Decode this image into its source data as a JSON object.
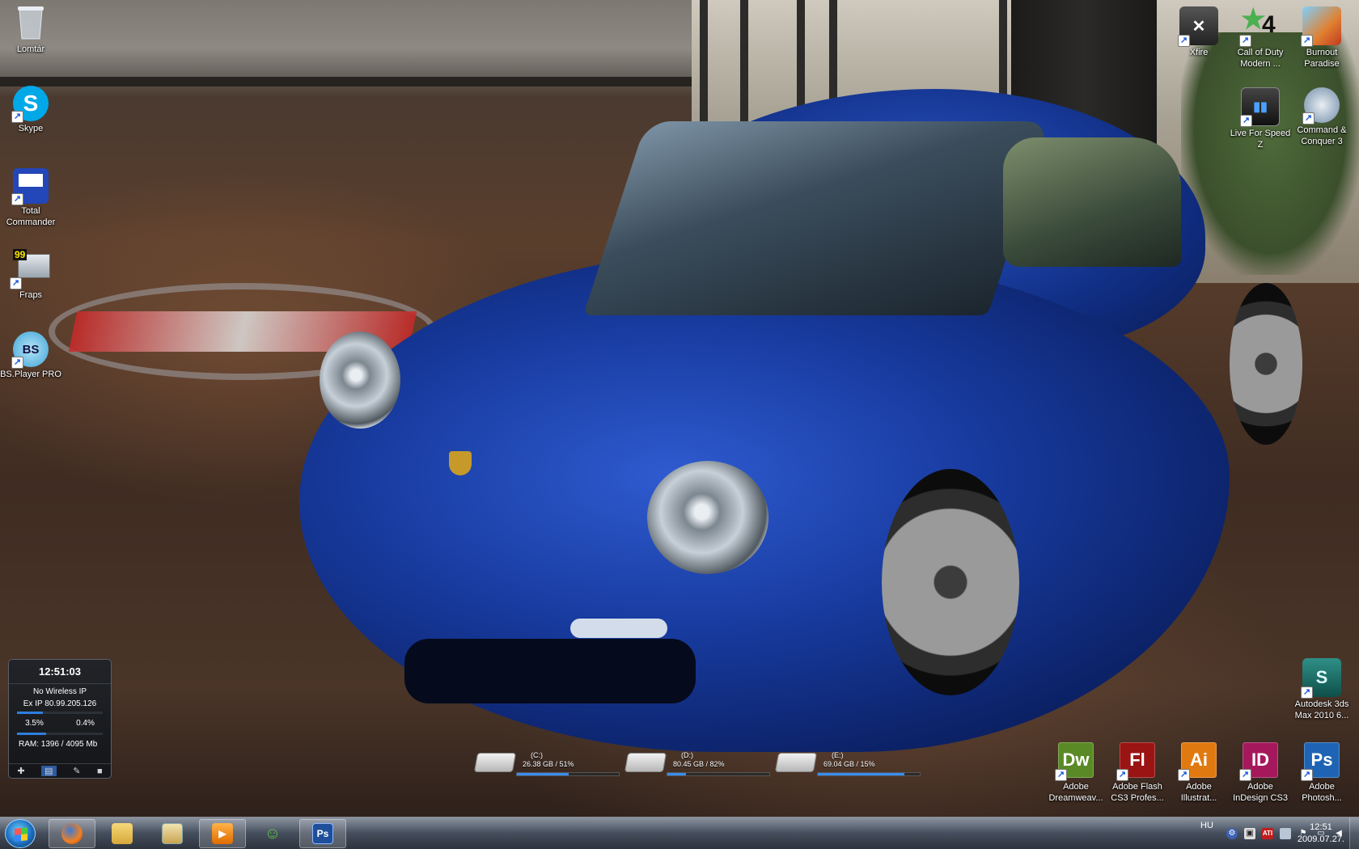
{
  "desktop": {
    "left_icons": [
      {
        "label": "Lomtár",
        "icon": "recycle-bin-icon"
      },
      {
        "label": "Skype",
        "icon": "skype-icon"
      },
      {
        "label": "Total Commander",
        "icon": "floppy-disk-icon"
      },
      {
        "label": "Fraps",
        "icon": "fraps-monitor-icon",
        "badge": "99"
      },
      {
        "label": "BS.Player PRO",
        "icon": "bsplayer-icon",
        "glyph": "BS"
      }
    ],
    "right_icons": [
      {
        "label": "Xfire",
        "icon": "xfire-icon"
      },
      {
        "label": "Call of Duty Modern ...",
        "icon": "call-of-duty-icon",
        "glyph": "4"
      },
      {
        "label": "Burnout Paradise",
        "icon": "burnout-paradise-icon"
      },
      {
        "label": "Live For Speed Z",
        "icon": "live-for-speed-icon"
      },
      {
        "label": "Command & Conquer 3",
        "icon": "command-and-conquer-icon"
      },
      {
        "label": "Autodesk 3ds Max 2010 6...",
        "icon": "3ds-max-icon"
      }
    ],
    "adobe_icons": [
      {
        "label": "Adobe Dreamweav...",
        "glyph": "Dw",
        "color": "#5a8a25"
      },
      {
        "label": "Adobe Flash CS3 Profes...",
        "glyph": "Fl",
        "color": "#9a1414"
      },
      {
        "label": "Adobe Illustrat...",
        "glyph": "Ai",
        "color": "#e07a10"
      },
      {
        "label": "Adobe InDesign CS3",
        "glyph": "ID",
        "color": "#a5195c"
      },
      {
        "label": "Adobe Photosh...",
        "glyph": "Ps",
        "color": "#1f64b4"
      }
    ]
  },
  "gadget": {
    "time": "12:51:03",
    "wireless": "No Wireless IP",
    "ext_ip": "Ex IP 80.99.205.126",
    "cpu1": "3.5%",
    "cpu2": "0.4%",
    "cpu1_fraction": 0.035,
    "cpu2_fraction": 0.004,
    "ram": "RAM: 1396 / 4095 Mb",
    "ram_fraction": 0.34
  },
  "drives": [
    {
      "letter": "(C:)",
      "info": "26.38 GB / 51%",
      "used_fraction": 0.51
    },
    {
      "letter": "(D:)",
      "info": "80.45 GB / 82%",
      "used_fraction": 0.18
    },
    {
      "letter": "(E:)",
      "info": "69.04 GB / 15%",
      "used_fraction": 0.85
    }
  ],
  "taskbar": {
    "apps": [
      {
        "name": "firefox",
        "icon": "firefox-icon",
        "active": true
      },
      {
        "name": "explorer",
        "icon": "folder-icon",
        "active": false
      },
      {
        "name": "explorer-window",
        "icon": "folder-window-icon",
        "active": false
      },
      {
        "name": "media-player",
        "icon": "media-player-icon",
        "active": true
      },
      {
        "name": "messenger",
        "icon": "messenger-icon",
        "active": false
      },
      {
        "name": "photoshop",
        "icon": "photoshop-icon",
        "glyph": "Ps",
        "active": true
      }
    ],
    "language": "HU",
    "clock_time": "12:51",
    "clock_date": "2009.07.27."
  },
  "colors": {
    "taskbar_accent": "#2d7fe0",
    "car_blue": "#173a9e"
  }
}
